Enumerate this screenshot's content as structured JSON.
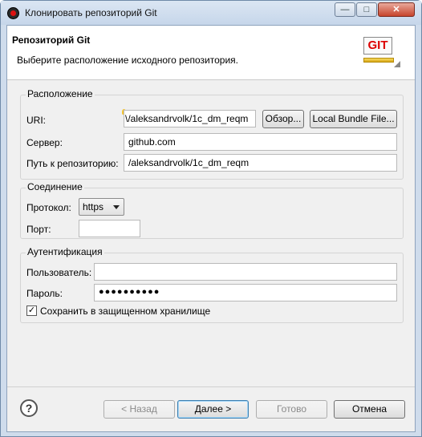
{
  "window": {
    "title": "Клонировать репозиторий Git",
    "minimize": "—",
    "maximize": "□",
    "close": "✕"
  },
  "header": {
    "title": "Репозиторий Git",
    "description": "Выберите расположение исходного репозитория.",
    "logo_text": "GIT"
  },
  "location": {
    "group_title": "Расположение",
    "uri_label": "URI:",
    "uri_value": "\\/aleksandrvolk/1c_dm_reqm",
    "browse_button": "Обзор...",
    "bundle_button": "Local Bundle File...",
    "server_label": "Сервер:",
    "server_value": "github.com",
    "path_label": "Путь к репозиторию:",
    "path_value": "/aleksandrvolk/1c_dm_reqm"
  },
  "connection": {
    "group_title": "Соединение",
    "protocol_label": "Протокол:",
    "protocol_value": "https",
    "port_label": "Порт:",
    "port_value": ""
  },
  "auth": {
    "group_title": "Аутентификация",
    "user_label": "Пользователь:",
    "user_value": "",
    "password_label": "Пароль:",
    "password_value": "●●●●●●●●●●",
    "save_label": "Сохранить в защищенном хранилище",
    "save_checked": "✓"
  },
  "footer": {
    "help": "?",
    "back": "< Назад",
    "next": "Далее >",
    "finish": "Готово",
    "cancel": "Отмена"
  }
}
